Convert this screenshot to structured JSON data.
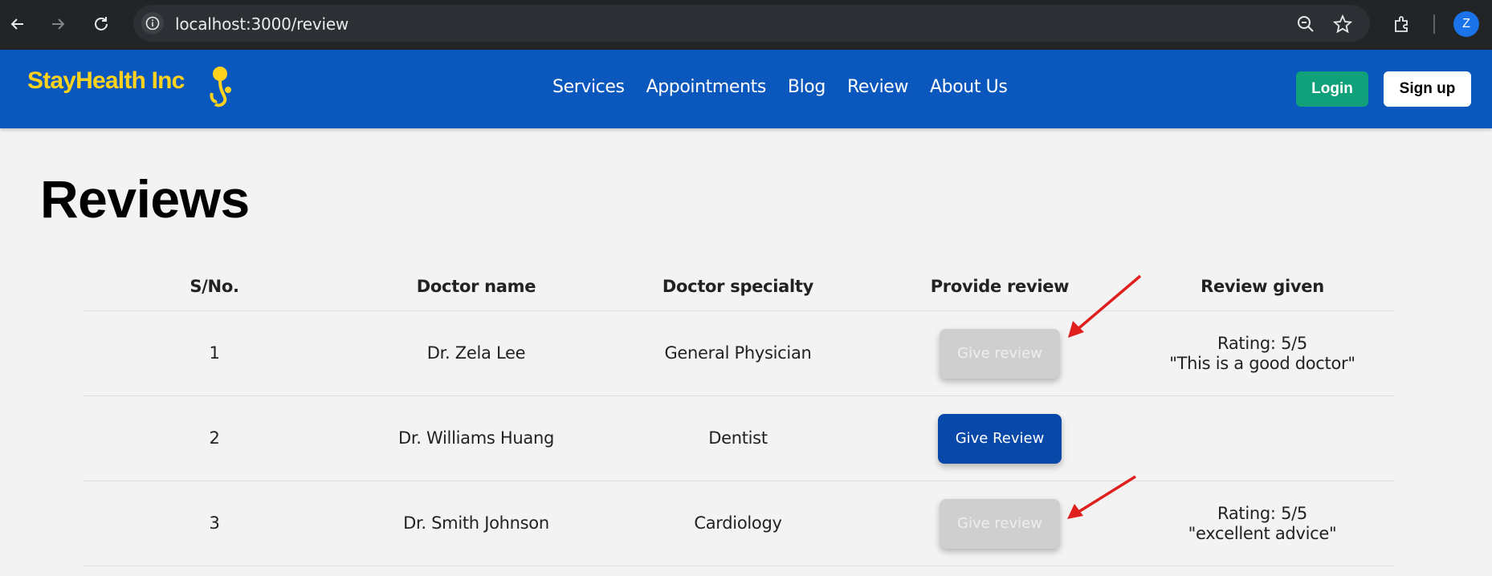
{
  "browser": {
    "url": "localhost:3000/review",
    "profile_initial": "Z"
  },
  "navbar": {
    "brand": "StayHealth Inc",
    "links": [
      "Services",
      "Appointments",
      "Blog",
      "Review",
      "About Us"
    ],
    "login_label": "Login",
    "signup_label": "Sign up",
    "colors": {
      "bar": "#0a57bd",
      "brand": "#ffd21e",
      "login": "#10a07a"
    }
  },
  "page": {
    "title": "Reviews"
  },
  "table": {
    "headers": [
      "S/No.",
      "Doctor name",
      "Doctor specialty",
      "Provide review",
      "Review given"
    ],
    "rows": [
      {
        "sno": "1",
        "doctor": "Dr. Zela Lee",
        "specialty": "General Physician",
        "button_label": "Give review",
        "button_state": "disabled",
        "rating": "Rating: 5/5",
        "comment": "\"This is a good doctor\""
      },
      {
        "sno": "2",
        "doctor": "Dr. Williams Huang",
        "specialty": "Dentist",
        "button_label": "Give Review",
        "button_state": "active",
        "rating": "",
        "comment": ""
      },
      {
        "sno": "3",
        "doctor": "Dr. Smith Johnson",
        "specialty": "Cardiology",
        "button_label": "Give review",
        "button_state": "disabled",
        "rating": "Rating: 5/5",
        "comment": "\"excellent advice\""
      }
    ]
  }
}
